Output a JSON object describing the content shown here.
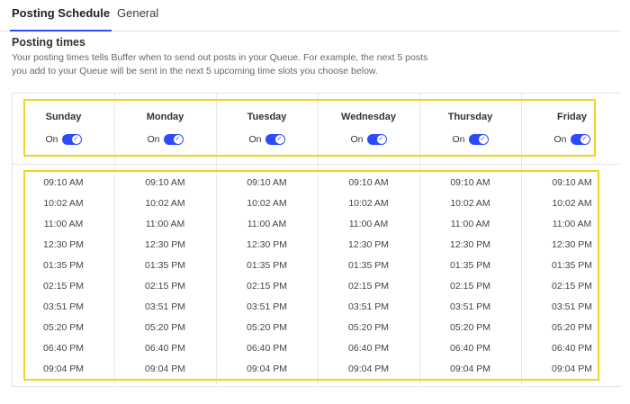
{
  "tabs": [
    {
      "label": "Posting Schedule",
      "active": true
    },
    {
      "label": "General",
      "active": false
    }
  ],
  "section": {
    "title": "Posting times",
    "description": "Your posting times tells Buffer when to send out posts in your Queue. For example, the next 5 posts you add to your Queue will be sent in the next 5 upcoming time slots you choose below."
  },
  "days": [
    {
      "name": "Sunday",
      "toggle_label": "On"
    },
    {
      "name": "Monday",
      "toggle_label": "On"
    },
    {
      "name": "Tuesday",
      "toggle_label": "On"
    },
    {
      "name": "Wednesday",
      "toggle_label": "On"
    },
    {
      "name": "Thursday",
      "toggle_label": "On"
    },
    {
      "name": "Friday",
      "toggle_label": "On"
    }
  ],
  "times": [
    "09:10 AM",
    "10:02 AM",
    "11:00 AM",
    "12:30 PM",
    "01:35 PM",
    "02:15 PM",
    "03:51 PM",
    "05:20 PM",
    "06:40 PM",
    "09:04 PM"
  ],
  "colors": {
    "accent": "#2c4bff",
    "highlight": "#f2d41e"
  }
}
